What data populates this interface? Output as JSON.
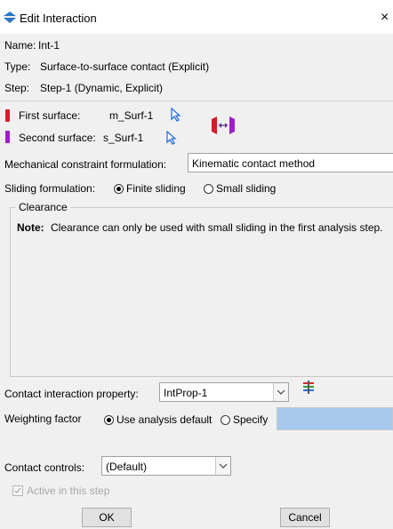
{
  "window": {
    "title": "Edit Interaction",
    "close": "×"
  },
  "info": {
    "name_label": "Name:",
    "name": "Int-1",
    "type_label": "Type:",
    "type": "Surface-to-surface contact (Explicit)",
    "step_label": "Step:",
    "step": "Step-1 (Dynamic, Explicit)"
  },
  "surfaces": {
    "first_label": "First surface:",
    "first": "m_Surf-1",
    "second_label": "Second surface:",
    "second": "s_Surf-1"
  },
  "mechanical": {
    "label": "Mechanical constraint formulation:",
    "value": "Kinematic contact method"
  },
  "sliding": {
    "label": "Sliding formulation:",
    "finite": "Finite sliding",
    "small": "Small sliding",
    "selected": "finite"
  },
  "clearance": {
    "title": "Clearance",
    "note_label": "Note:",
    "note": "Clearance can only be used with small sliding in the first analysis step."
  },
  "property": {
    "label": "Contact interaction property:",
    "value": "IntProp-1"
  },
  "weighting": {
    "label": "Weighting factor",
    "default": "Use analysis default",
    "specify": "Specify",
    "value": ""
  },
  "controls": {
    "label": "Contact controls:",
    "value": "(Default)"
  },
  "active": {
    "label": "Active in this step"
  },
  "buttons": {
    "ok": "OK",
    "cancel": "Cancel"
  },
  "colors": {
    "first_surface": "#d81b2a",
    "second_surface": "#a21ccb",
    "select_arrow": "#2a6fdb",
    "specify_field": "#a9c9ec"
  }
}
